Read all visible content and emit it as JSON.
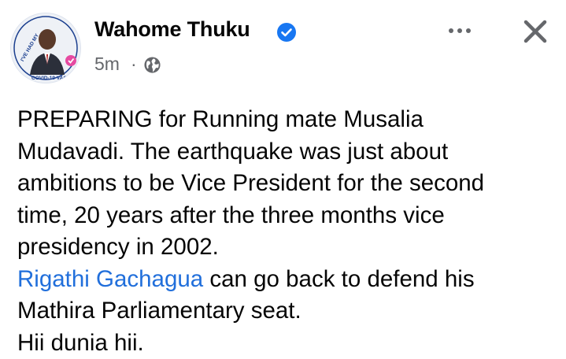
{
  "post": {
    "author": {
      "name": "Wahome Thuku",
      "avatar_icon": "profile-photo-with-covid-vaccine-badge",
      "avatar_badge_text": "I'VE HAD MY COVID-19 VACCINE",
      "verified_icon": "verified-badge-icon"
    },
    "meta": {
      "time": "5m",
      "separator": "·",
      "privacy_icon": "globe-icon"
    },
    "actions": {
      "more_icon": "more-options-icon",
      "close_icon": "close-icon"
    },
    "body": {
      "lines": [
        "PREPARING for Running mate Musalia",
        "Mudavadi. The earthquake was just about",
        "ambitions to be Vice President for the second",
        "time, 20 years after the three months vice",
        "presidency in 2002."
      ],
      "mention": "Rigathi Gachagua",
      "mention_rest": " can go back to defend his",
      "line7": "Mathira Parliamentary seat.",
      "line8": "Hii dunia hii."
    },
    "colors": {
      "text": "#050505",
      "secondary": "#65676b",
      "link": "#216fdb",
      "verified": "#1877f2"
    }
  }
}
